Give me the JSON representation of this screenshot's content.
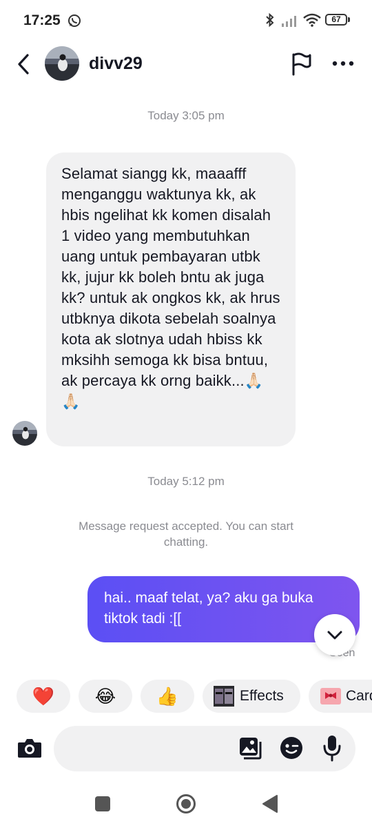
{
  "status_bar": {
    "time": "17:25",
    "battery": "67"
  },
  "header": {
    "username": "divv29"
  },
  "conversation": {
    "timestamp_1": "Today 3:05 pm",
    "incoming_message": "Selamat siangg kk, maaafff menganggu waktunya kk, ak hbis ngelihat kk komen disalah 1 video yang membutuhkan uang untuk pembayaran utbk kk, jujur kk boleh bntu ak juga kk? untuk ak ongkos kk, ak hrus utbknya dikota sebelah soalnya kota ak slotnya udah hbiss kk mksihh semoga kk bisa bntuu, ak percaya kk orng baikk...🙏🏻🙏🏻",
    "timestamp_2": "Today 5:12 pm",
    "system_message": "Message request accepted. You can start chatting.",
    "outgoing_message": "hai.. maaf telat, ya? aku ga buka tiktok tadi :[[",
    "seen_label": "Seen"
  },
  "quick_replies": [
    {
      "emoji": "❤️",
      "label": ""
    },
    {
      "emoji": "😂",
      "label": ""
    },
    {
      "emoji": "👍",
      "label": ""
    },
    {
      "emoji": "",
      "label": "Effects"
    },
    {
      "emoji": "🎀",
      "label": "Card"
    }
  ],
  "composer": {
    "placeholder": ""
  },
  "colors": {
    "outgoing_start": "#5b4ff4",
    "outgoing_end": "#7f55ef",
    "bubble_gray": "#f1f1f2"
  }
}
